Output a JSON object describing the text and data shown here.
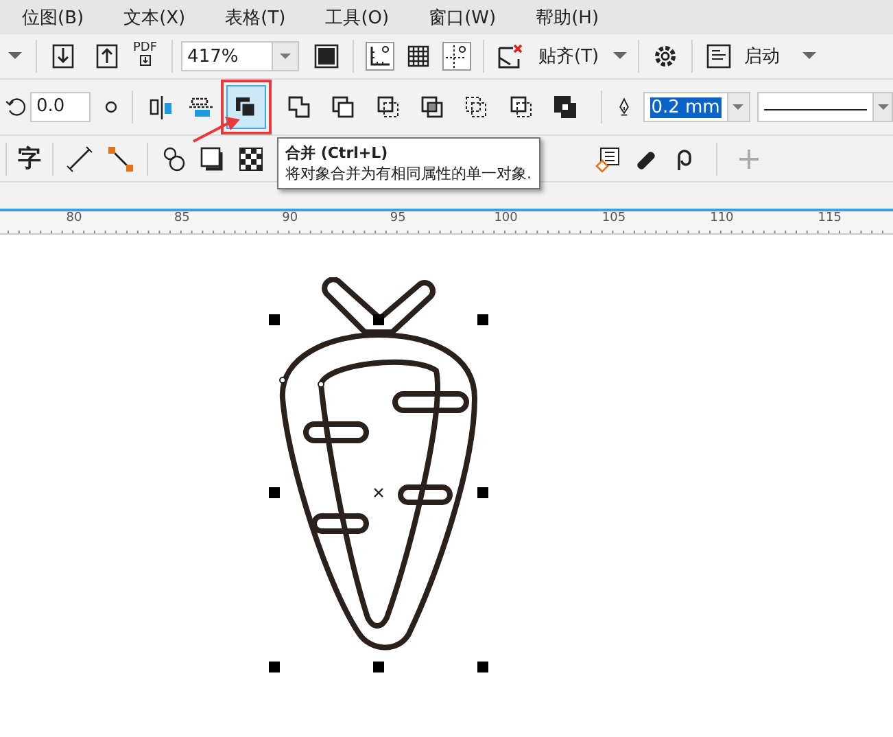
{
  "menu": [
    {
      "label": "位图(B)"
    },
    {
      "label": "文本(X)"
    },
    {
      "label": "表格(T)"
    },
    {
      "label": "工具(O)"
    },
    {
      "label": "窗口(W)"
    },
    {
      "label": "帮助(H)"
    }
  ],
  "standard_bar": {
    "pdf_label": "PDF",
    "zoom": "417%",
    "snap": "贴齐(T)",
    "launch": "启动"
  },
  "property_bar": {
    "rotation": "0.0",
    "shaping_buttons": [
      {
        "kind": "combine",
        "selected": true
      },
      {
        "kind": "weld",
        "selected": false
      },
      {
        "kind": "trim",
        "selected": false
      },
      {
        "kind": "intersect",
        "selected": false
      },
      {
        "kind": "simplify",
        "selected": false
      },
      {
        "kind": "front",
        "selected": false
      },
      {
        "kind": "back",
        "selected": false
      },
      {
        "kind": "boundary",
        "selected": false
      }
    ],
    "outline_width": "0.2 mm"
  },
  "toolbox_row": {
    "text_tool": "字"
  },
  "tooltip": {
    "title": "合并 (Ctrl+L)",
    "description": "将对象合并为有相同属性的单一对象."
  },
  "ruler": {
    "labels": [
      "80",
      "85",
      "90",
      "95",
      "100",
      "105",
      "110",
      "115"
    ]
  }
}
